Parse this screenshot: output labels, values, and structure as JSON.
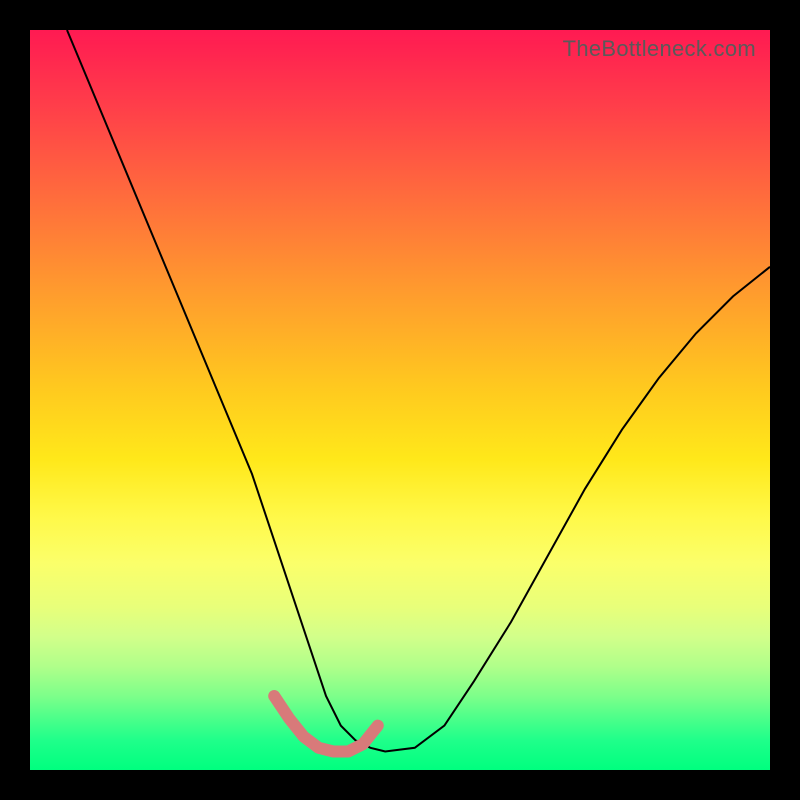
{
  "watermark": "TheBottleneck.com",
  "chart_data": {
    "type": "line",
    "title": "",
    "xlabel": "",
    "ylabel": "",
    "xlim": [
      0,
      100
    ],
    "ylim": [
      0,
      100
    ],
    "series": [
      {
        "name": "black-curve",
        "stroke": "#000000",
        "stroke_width": 2,
        "x": [
          5,
          10,
          15,
          20,
          25,
          30,
          33,
          36,
          38,
          40,
          42,
          44,
          46,
          48,
          52,
          56,
          60,
          65,
          70,
          75,
          80,
          85,
          90,
          95,
          100
        ],
        "y": [
          100,
          88,
          76,
          64,
          52,
          40,
          31,
          22,
          16,
          10,
          6,
          4,
          3,
          2.5,
          3,
          6,
          12,
          20,
          29,
          38,
          46,
          53,
          59,
          64,
          68
        ]
      },
      {
        "name": "pink-band",
        "stroke": "#d87a7a",
        "stroke_width": 12,
        "cap": "round",
        "x": [
          33,
          35,
          37,
          39,
          41,
          43,
          45,
          47
        ],
        "y": [
          10,
          7,
          4.5,
          3,
          2.5,
          2.5,
          3.5,
          6
        ]
      }
    ],
    "annotations": []
  },
  "colors": {
    "background": "#000000",
    "gradient_top": "#ff1a52",
    "gradient_bottom": "#00ff7f",
    "curve": "#000000",
    "band": "#d87a7a",
    "watermark": "#5a5a5a"
  }
}
